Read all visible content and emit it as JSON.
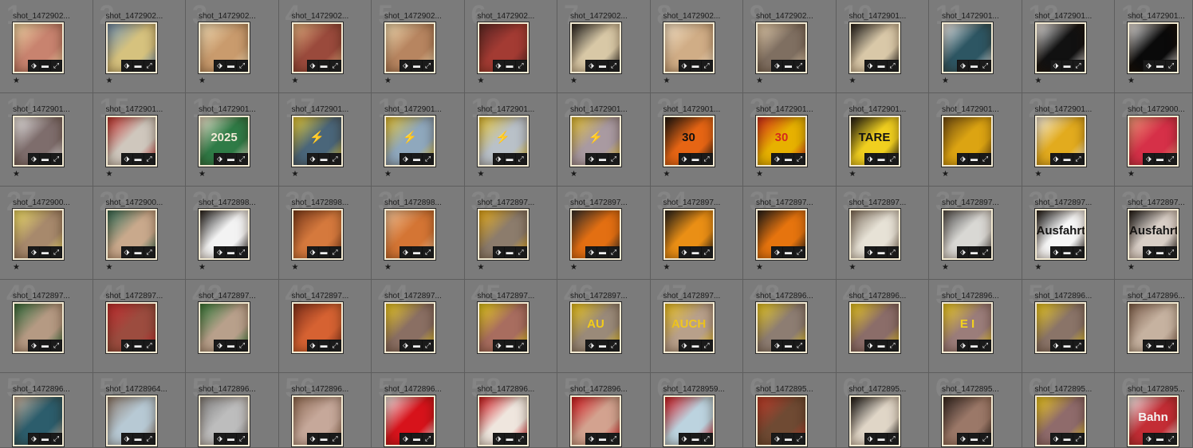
{
  "grid": {
    "cells": [
      {
        "filename": "shot_1472902...",
        "rating": "★",
        "bg": "#c8836f",
        "accent": "#f1d9a8",
        "label": "",
        "bgnum": "1"
      },
      {
        "filename": "shot_1472902...",
        "rating": "★",
        "bg": "#d6c27e",
        "accent": "#6a8fb5",
        "label": "",
        "bgnum": "2"
      },
      {
        "filename": "shot_1472902...",
        "rating": "★",
        "bg": "#c99b6d",
        "accent": "#f2dfb8",
        "label": "",
        "bgnum": "3"
      },
      {
        "filename": "shot_1472902...",
        "rating": "★",
        "bg": "#9a4a3c",
        "accent": "#e4b483",
        "label": "",
        "bgnum": "4"
      },
      {
        "filename": "shot_1472902...",
        "rating": "★",
        "bg": "#b78560",
        "accent": "#f4e0b6",
        "label": "",
        "bgnum": "5"
      },
      {
        "filename": "shot_1472902...",
        "rating": "★",
        "bg": "#a33b33",
        "accent": "#552424",
        "label": "",
        "bgnum": "6"
      },
      {
        "filename": "shot_1472902...",
        "rating": "★",
        "bg": "#d8c8a6",
        "accent": "#1f1f1f",
        "label": "",
        "bgnum": "7"
      },
      {
        "filename": "shot_1472902...",
        "rating": "★",
        "bg": "#d0ad86",
        "accent": "#f6e5ca",
        "label": "",
        "bgnum": "8"
      },
      {
        "filename": "shot_1472902...",
        "rating": "★",
        "bg": "#7f6f61",
        "accent": "#e9d3b2",
        "label": "",
        "bgnum": "9"
      },
      {
        "filename": "shot_1472901...",
        "rating": "★",
        "bg": "#d9c8a8",
        "accent": "#1a1a1a",
        "label": "",
        "bgnum": "10"
      },
      {
        "filename": "shot_1472901...",
        "rating": "★",
        "bg": "#2d5663",
        "accent": "#efefef",
        "label": "",
        "bgnum": "11"
      },
      {
        "filename": "shot_1472901...",
        "rating": "★",
        "bg": "#111111",
        "accent": "#f6f6f6",
        "label": "",
        "bgnum": "12"
      },
      {
        "filename": "shot_1472901...",
        "rating": "★",
        "bg": "#0a0a0a",
        "accent": "#f4f4f4",
        "label": "",
        "bgnum": "13"
      },
      {
        "filename": "shot_1472901...",
        "rating": "★",
        "bg": "#7e6d6c",
        "accent": "#f2f2f2",
        "label": "",
        "bgnum": "14"
      },
      {
        "filename": "shot_1472901...",
        "rating": "★",
        "bg": "#cfc7bd",
        "accent": "#c1302e",
        "label": "",
        "bgnum": "15"
      },
      {
        "filename": "shot_1472901...",
        "rating": "★",
        "bg": "#2f7b46",
        "accent": "#f2ead7",
        "label": "2025",
        "bgnum": "16"
      },
      {
        "filename": "shot_1472901...",
        "rating": "★",
        "bg": "#4a667a",
        "accent": "#f0d437",
        "label": "⚡",
        "bgnum": "17"
      },
      {
        "filename": "shot_1472901...",
        "rating": "★",
        "bg": "#8fa8bd",
        "accent": "#e9c631",
        "label": "⚡",
        "bgnum": "18"
      },
      {
        "filename": "shot_1472901...",
        "rating": "★",
        "bg": "#b9c1c8",
        "accent": "#e9c631",
        "label": "⚡",
        "bgnum": "19"
      },
      {
        "filename": "shot_1472901...",
        "rating": "★",
        "bg": "#a99aa1",
        "accent": "#e9c631",
        "label": "⚡",
        "bgnum": "20"
      },
      {
        "filename": "shot_1472901...",
        "rating": "★",
        "bg": "#e66514",
        "accent": "#111111",
        "label": "30",
        "bgnum": "21"
      },
      {
        "filename": "shot_1472901...",
        "rating": "★",
        "bg": "#e7b100",
        "accent": "#d5281c",
        "label": "30",
        "bgnum": "22"
      },
      {
        "filename": "shot_1472901...",
        "rating": "★",
        "bg": "#f0cf1f",
        "accent": "#141414",
        "label": "TARE",
        "bgnum": "23"
      },
      {
        "filename": "shot_1472901...",
        "rating": "★",
        "bg": "#dca412",
        "accent": "#6b4a12",
        "label": "",
        "bgnum": "24"
      },
      {
        "filename": "shot_1472901...",
        "rating": "★",
        "bg": "#e2ab1e",
        "accent": "#f6f2e8",
        "label": "",
        "bgnum": "25"
      },
      {
        "filename": "shot_1472900...",
        "rating": "★",
        "bg": "#d63048",
        "accent": "#f09a7b",
        "label": "",
        "bgnum": "26"
      },
      {
        "filename": "shot_1472900...",
        "rating": "★",
        "bg": "#a7896c",
        "accent": "#f3e46a",
        "label": "",
        "bgnum": "27"
      },
      {
        "filename": "shot_1472900...",
        "rating": "★",
        "bg": "#c9a98c",
        "accent": "#2d6c58",
        "label": "",
        "bgnum": "28"
      },
      {
        "filename": "shot_1472898...",
        "rating": "★",
        "bg": "#f3f3f3",
        "accent": "#1d1d1d",
        "label": "",
        "bgnum": "29"
      },
      {
        "filename": "shot_1472898...",
        "rating": "★",
        "bg": "#d5793d",
        "accent": "#7b3a1c",
        "label": "",
        "bgnum": "30"
      },
      {
        "filename": "shot_1472898...",
        "rating": "★",
        "bg": "#d47534",
        "accent": "#f0c49a",
        "label": "",
        "bgnum": "31"
      },
      {
        "filename": "shot_1472897...",
        "rating": "★",
        "bg": "#8c7c6c",
        "accent": "#f0b41b",
        "label": "",
        "bgnum": "32"
      },
      {
        "filename": "shot_1472897...",
        "rating": "★",
        "bg": "#e36f12",
        "accent": "#2b2b2b",
        "label": "",
        "bgnum": "33"
      },
      {
        "filename": "shot_1472897...",
        "rating": "★",
        "bg": "#ea8f15",
        "accent": "#1b1b1b",
        "label": "",
        "bgnum": "34"
      },
      {
        "filename": "shot_1472897...",
        "rating": "★",
        "bg": "#e6740e",
        "accent": "#1a1a1a",
        "label": "",
        "bgnum": "35"
      },
      {
        "filename": "shot_1472897...",
        "rating": "★",
        "bg": "#e7e2d6",
        "accent": "#7e7161",
        "label": "",
        "bgnum": "36"
      },
      {
        "filename": "shot_1472897...",
        "rating": "★",
        "bg": "#d9d8d4",
        "accent": "#4a4a4a",
        "label": "",
        "bgnum": "37"
      },
      {
        "filename": "shot_1472897...",
        "rating": "★",
        "bg": "#f6f6f6",
        "accent": "#151515",
        "label": "Ausfahrt",
        "bgnum": "38"
      },
      {
        "filename": "shot_1472897...",
        "rating": "★",
        "bg": "#d9cfc7",
        "accent": "#161616",
        "label": "Ausfahrt",
        "bgnum": "39"
      },
      {
        "filename": "shot_1472897...",
        "rating": "",
        "bg": "#b59a83",
        "accent": "#2c6b3b",
        "label": "",
        "bgnum": "40"
      },
      {
        "filename": "shot_1472897...",
        "rating": "",
        "bg": "#9c4c3f",
        "accent": "#c62b2f",
        "label": "",
        "bgnum": "41"
      },
      {
        "filename": "shot_1472897...",
        "rating": "",
        "bg": "#b8a08b",
        "accent": "#2f7a3a",
        "label": "",
        "bgnum": "42"
      },
      {
        "filename": "shot_1472897...",
        "rating": "",
        "bg": "#d66232",
        "accent": "#7e2f1c",
        "label": "",
        "bgnum": "43"
      },
      {
        "filename": "shot_1472897...",
        "rating": "",
        "bg": "#8a6f63",
        "accent": "#f2d122",
        "label": "",
        "bgnum": "44"
      },
      {
        "filename": "shot_1472897...",
        "rating": "",
        "bg": "#a86d5f",
        "accent": "#e9d21a",
        "label": "",
        "bgnum": "45"
      },
      {
        "filename": "shot_1472897...",
        "rating": "",
        "bg": "#9a8a79",
        "accent": "#f3cc19",
        "label": "AU",
        "bgnum": "46"
      },
      {
        "filename": "shot_1472897...",
        "rating": "",
        "bg": "#b8a08a",
        "accent": "#f0c61e",
        "label": "AUCH",
        "bgnum": "47"
      },
      {
        "filename": "shot_1472896...",
        "rating": "",
        "bg": "#8d7d72",
        "accent": "#f0d120",
        "label": "",
        "bgnum": "48"
      },
      {
        "filename": "shot_1472896...",
        "rating": "",
        "bg": "#8b6d69",
        "accent": "#f2d11f",
        "label": "",
        "bgnum": "49"
      },
      {
        "filename": "shot_1472896...",
        "rating": "",
        "bg": "#9b7d7a",
        "accent": "#f2d11f",
        "label": "E I",
        "bgnum": "50"
      },
      {
        "filename": "shot_1472896...",
        "rating": "",
        "bg": "#8a7468",
        "accent": "#f2d11f",
        "label": "",
        "bgnum": "51"
      },
      {
        "filename": "shot_1472896...",
        "rating": "",
        "bg": "#c6b2a0",
        "accent": "#7c5f4d",
        "label": "",
        "bgnum": "52"
      },
      {
        "filename": "shot_1472896...",
        "rating": "",
        "bg": "#2c5d6c",
        "accent": "#cdb8a5",
        "label": "",
        "bgnum": "53"
      },
      {
        "filename": "shot_14728964...",
        "rating": "",
        "bg": "#b7c9d4",
        "accent": "#8b7b6f",
        "label": "",
        "bgnum": "54"
      },
      {
        "filename": "shot_1472896...",
        "rating": "",
        "bg": "#bdbdbd",
        "accent": "#7f7f7f",
        "label": "",
        "bgnum": "55"
      },
      {
        "filename": "shot_1472896...",
        "rating": "",
        "bg": "#c6a89a",
        "accent": "#8e6b55",
        "label": "",
        "bgnum": "56"
      },
      {
        "filename": "shot_1472896...",
        "rating": "",
        "bg": "#d7131b",
        "accent": "#f5f5f5",
        "label": "",
        "bgnum": "57"
      },
      {
        "filename": "shot_1472896...",
        "rating": "",
        "bg": "#efe6de",
        "accent": "#d1141c",
        "label": "",
        "bgnum": "58"
      },
      {
        "filename": "shot_1472896...",
        "rating": "",
        "bg": "#d3a28f",
        "accent": "#d3151e",
        "label": "",
        "bgnum": "59"
      },
      {
        "filename": "shot_14728959...",
        "rating": "",
        "bg": "#bcd3df",
        "accent": "#d11520",
        "label": "",
        "bgnum": "60"
      },
      {
        "filename": "shot_1472895...",
        "rating": "",
        "bg": "#6f4a33",
        "accent": "#c33b2a",
        "label": "",
        "bgnum": "61"
      },
      {
        "filename": "shot_1472895...",
        "rating": "",
        "bg": "#e0d6c7",
        "accent": "#111111",
        "label": "",
        "bgnum": "62"
      },
      {
        "filename": "shot_1472895...",
        "rating": "",
        "bg": "#9b7868",
        "accent": "#2d2421",
        "label": "",
        "bgnum": "63"
      },
      {
        "filename": "shot_1472895...",
        "rating": "",
        "bg": "#8f6b6b",
        "accent": "#f2d01e",
        "label": "",
        "bgnum": "64"
      },
      {
        "filename": "shot_1472895...",
        "rating": "",
        "bg": "#c32d35",
        "accent": "#f5f5f5",
        "label": "Bahn",
        "bgnum": "65"
      }
    ],
    "badges": {
      "tag_icon": "tag-icon",
      "comment_icon": "comment-icon",
      "edit_icon": "develop-edit-icon"
    }
  }
}
